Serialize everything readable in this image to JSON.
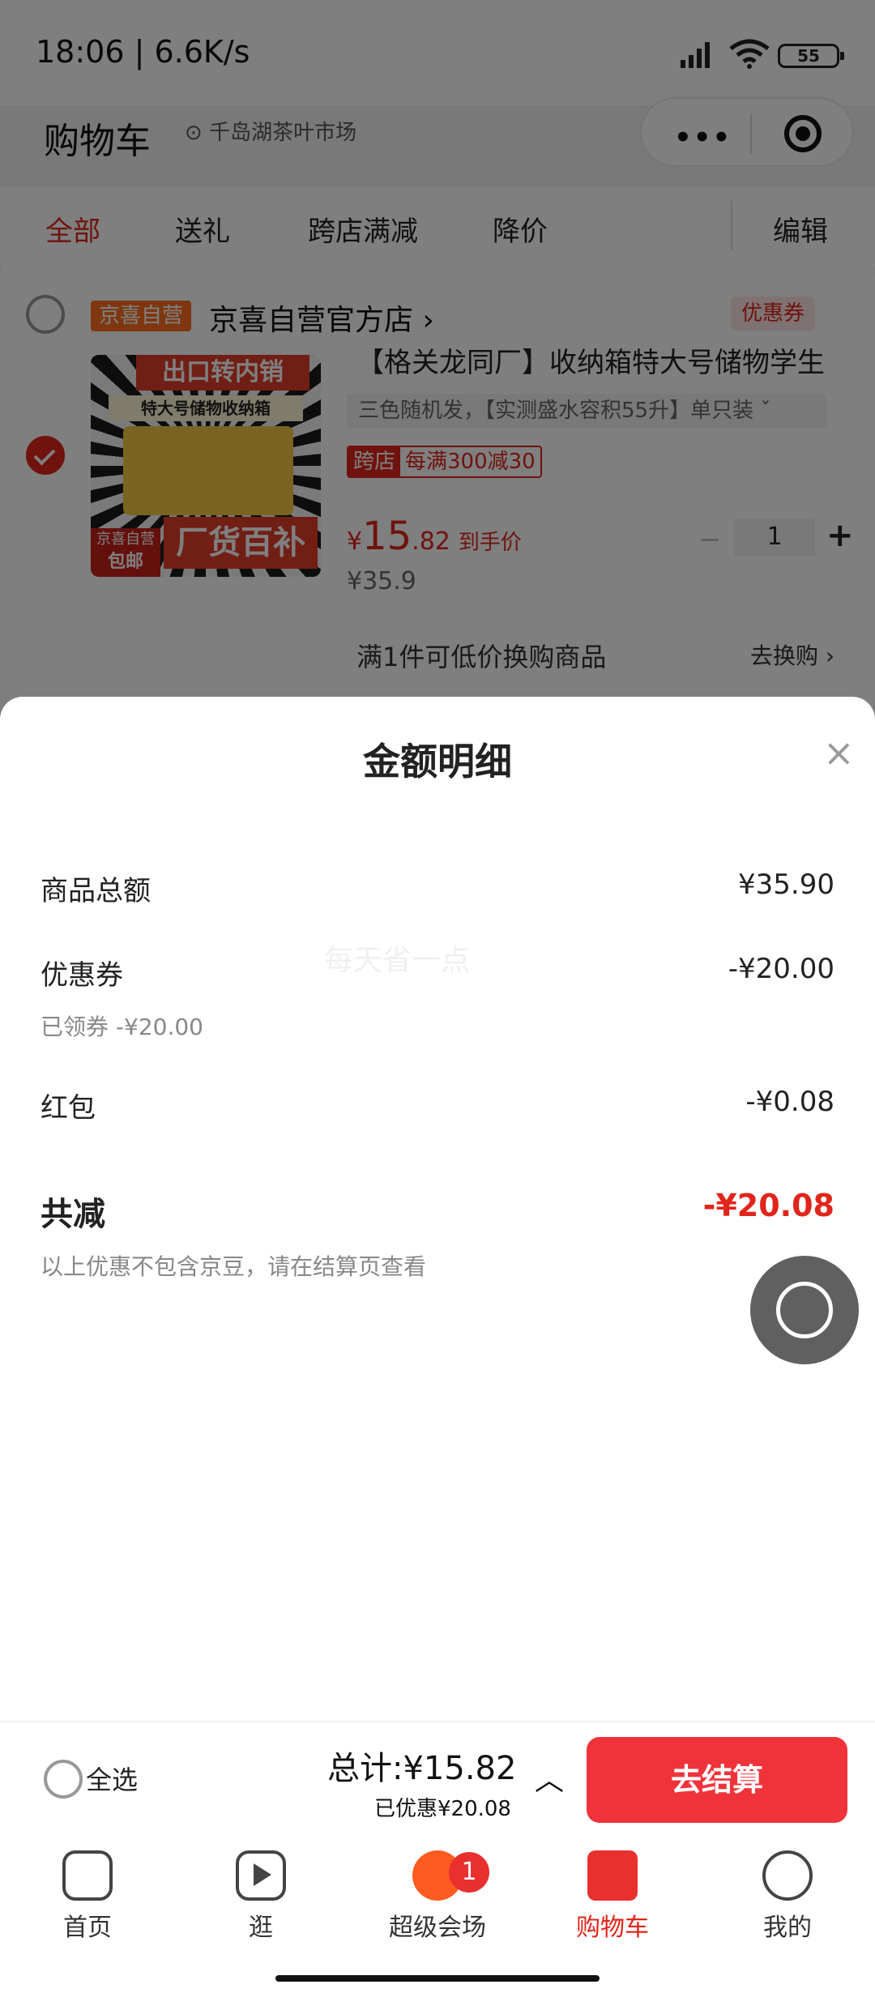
{
  "status": {
    "time": "18:06 | 6.6K/s",
    "battery": "55"
  },
  "header": {
    "title": "购物车",
    "location": "千岛湖茶叶市场",
    "capsule_more": "•••"
  },
  "tabs": [
    "全部",
    "送礼",
    "跨店满减",
    "降价",
    "编辑"
  ],
  "shop": {
    "tag": "京喜自营",
    "name": "京喜自营官方店 ›",
    "coupon": "优惠券"
  },
  "product": {
    "title": "【格关龙同厂】收纳箱特大号储物学生",
    "spec": "三色随机发，【实测盛水容积55升】单只装  ˇ",
    "promo_tag": "跨店",
    "promo_text": "每满300减30",
    "price_symbol": "¥",
    "price_int": "15",
    "price_dec": ".82",
    "price_label": "到手价",
    "original_price": "¥35.9",
    "quantity": "1",
    "image_texts": {
      "banner": "出口转内销",
      "sub": "特大号储物收纳箱",
      "big": "厂货百补",
      "badge_top": "京喜自营",
      "badge_bottom": "包邮"
    }
  },
  "swap": {
    "text": "满1件可低价换购商品",
    "link": "去换购 ›"
  },
  "sheet": {
    "title": "金额明细",
    "close": "×",
    "watermark": "每天省一点",
    "rows": [
      {
        "label": "商品总额",
        "value": "¥35.90"
      },
      {
        "label": "优惠券",
        "value": "-¥20.00",
        "sub": "已领券 -¥20.00"
      },
      {
        "label": "红包",
        "value": "-¥0.08"
      }
    ],
    "total": {
      "label": "共减",
      "value": "-¥20.08",
      "note": "以上优惠不包含京豆，请在结算页查看"
    }
  },
  "bottom_bar": {
    "select_all": "全选",
    "total": "总计:¥15.82",
    "saved": "已优惠¥20.08",
    "caret": "︿",
    "checkout": "去结算"
  },
  "nav": [
    {
      "label": "首页",
      "icon": "home-icon"
    },
    {
      "label": "逛",
      "icon": "play-icon"
    },
    {
      "label": "超级会场",
      "icon": "super-venue-icon",
      "badge": "1"
    },
    {
      "label": "购物车",
      "icon": "cart-icon",
      "active": true
    },
    {
      "label": "我的",
      "icon": "smiley-icon"
    }
  ],
  "colors": {
    "accent": "#e1251b",
    "checkout": "#f0333a",
    "tag_orange": "#ff6f1f"
  }
}
